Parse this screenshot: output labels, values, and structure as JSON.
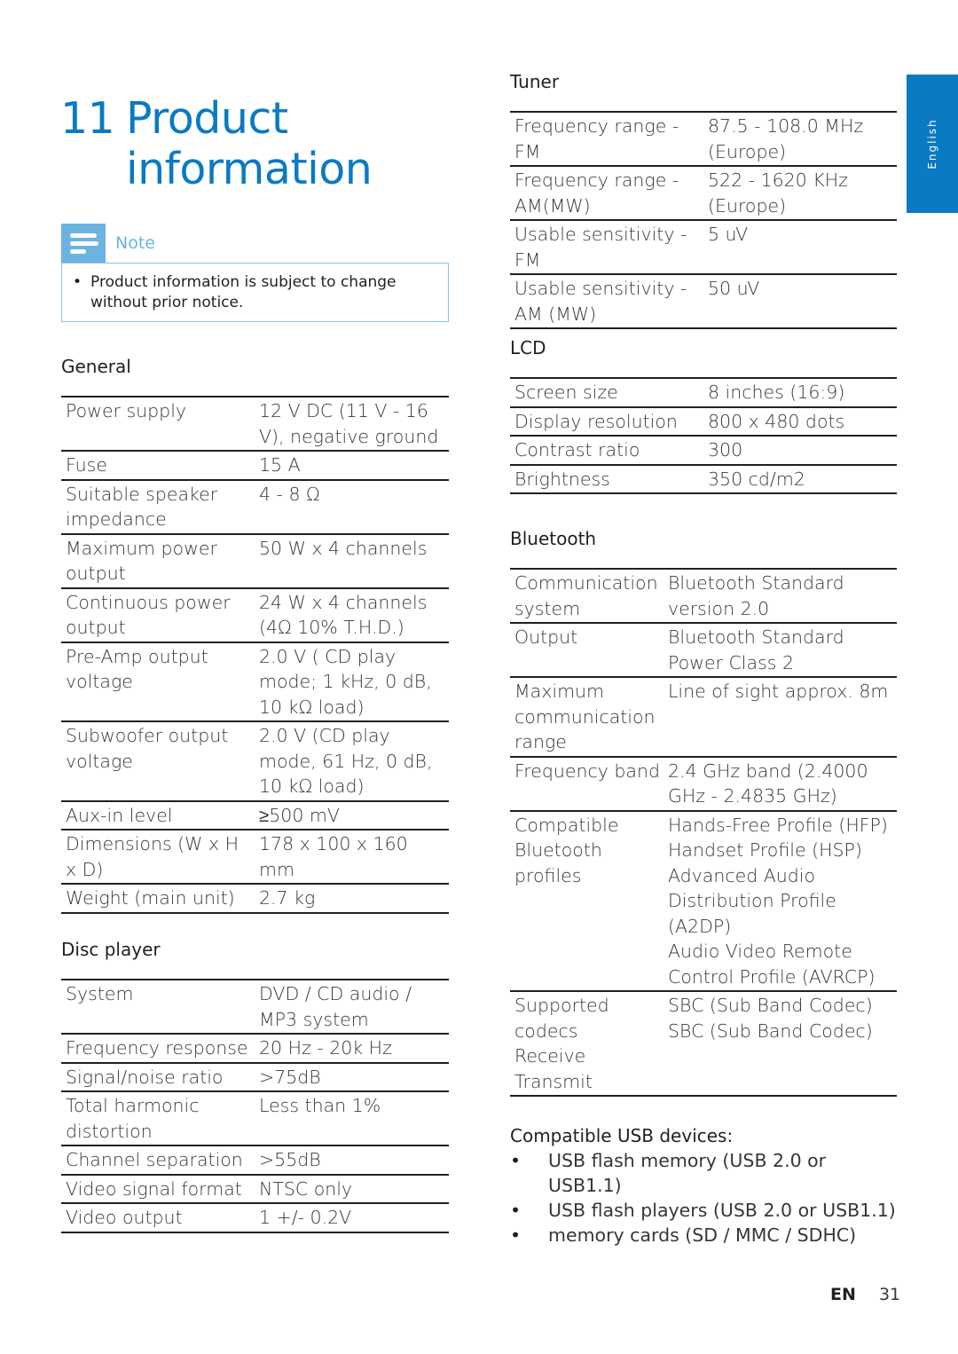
{
  "title": {
    "number": "11",
    "line1": "Product",
    "line2": "information"
  },
  "note": {
    "icon": "note-lines-icon",
    "label": "Note",
    "items": [
      "Product information is subject to change without prior notice."
    ]
  },
  "language_tab": "English",
  "general": {
    "heading": "General",
    "rows": [
      {
        "k": "Power supply",
        "v": "12 V DC (11 V - 16 V), negative ground"
      },
      {
        "k": "Fuse",
        "v": "15 A"
      },
      {
        "k": "Suitable speaker impedance",
        "v": "4 - 8 Ω"
      },
      {
        "k": "Maximum power output",
        "v": "50 W x 4 channels"
      },
      {
        "k": "Continuous power output",
        "v": "24 W x 4 channels (4Ω 10% T.H.D.)"
      },
      {
        "k": "Pre-Amp output voltage",
        "v": "2.0 V ( CD play mode; 1 kHz, 0 dB, 10 kΩ load)"
      },
      {
        "k": "Subwoofer output voltage",
        "v": "2.0 V (CD play mode, 61 Hz, 0 dB, 10 kΩ load)"
      },
      {
        "k": "Aux-in level",
        "v": "≥500 mV"
      },
      {
        "k": "Dimensions (W x H x D)",
        "v": "178 x 100 x 160 mm"
      },
      {
        "k": "Weight (main unit)",
        "v": "2.7 kg"
      }
    ]
  },
  "disc_player": {
    "heading": "Disc player",
    "rows": [
      {
        "k": "System",
        "v": "DVD / CD audio / MP3 system"
      },
      {
        "k": "Frequency response",
        "v": "20 Hz - 20k Hz"
      },
      {
        "k": "Signal/noise ratio",
        "v": ">75dB"
      },
      {
        "k": "Total harmonic distortion",
        "v": "Less than 1%"
      },
      {
        "k": "Channel separation",
        "v": ">55dB"
      },
      {
        "k": "Video signal format",
        "v": "NTSC only"
      },
      {
        "k": "Video output",
        "v": "1 +/- 0.2V"
      }
    ]
  },
  "tuner": {
    "heading": "Tuner",
    "rows": [
      {
        "k": "Frequency range - FM",
        "v": "87.5 - 108.0 MHz (Europe)"
      },
      {
        "k": "Frequency range - AM(MW)",
        "v": "522 - 1620 KHz (Europe)"
      },
      {
        "k": "Usable sensitivity - FM",
        "v": "5 uV"
      },
      {
        "k": "Usable sensitivity - AM (MW)",
        "v": "50 uV"
      }
    ]
  },
  "lcd": {
    "heading": "LCD",
    "rows": [
      {
        "k": "Screen size",
        "v": "8 inches (16:9)"
      },
      {
        "k": "Display resolution",
        "v": "800 x 480 dots"
      },
      {
        "k": "Contrast ratio",
        "v": "300"
      },
      {
        "k": "Brightness",
        "v": "350 cd/m2"
      }
    ]
  },
  "bluetooth": {
    "heading": "Bluetooth",
    "rows": [
      {
        "k": "Communication system",
        "v": "Bluetooth Standard version 2.0"
      },
      {
        "k": "Output",
        "v": "Bluetooth Standard Power Class 2"
      },
      {
        "k": "Maximum communication range",
        "v": "Line of sight approx. 8m"
      },
      {
        "k": "Frequency band",
        "v": "2.4 GHz band (2.4000 GHz - 2.4835 GHz)"
      },
      {
        "k": "Compatible Bluetooth profiles",
        "v": "Hands-Free Profile (HFP)\nHandset Profile (HSP)\nAdvanced Audio Distribution Profile (A2DP)\nAudio Video Remote Control Profile (AVRCP)"
      },
      {
        "k": "Supported codecs\nReceive\nTransmit",
        "v": "SBC (Sub Band Codec)\nSBC (Sub Band Codec)"
      }
    ]
  },
  "usb": {
    "heading": "Compatible USB devices:",
    "items": [
      "USB flash memory (USB 2.0 or USB1.1)",
      "USB flash players (USB 2.0 or USB1.1)",
      "memory cards (SD / MMC / SDHC)"
    ]
  },
  "footer": {
    "lang": "EN",
    "page": "31"
  }
}
